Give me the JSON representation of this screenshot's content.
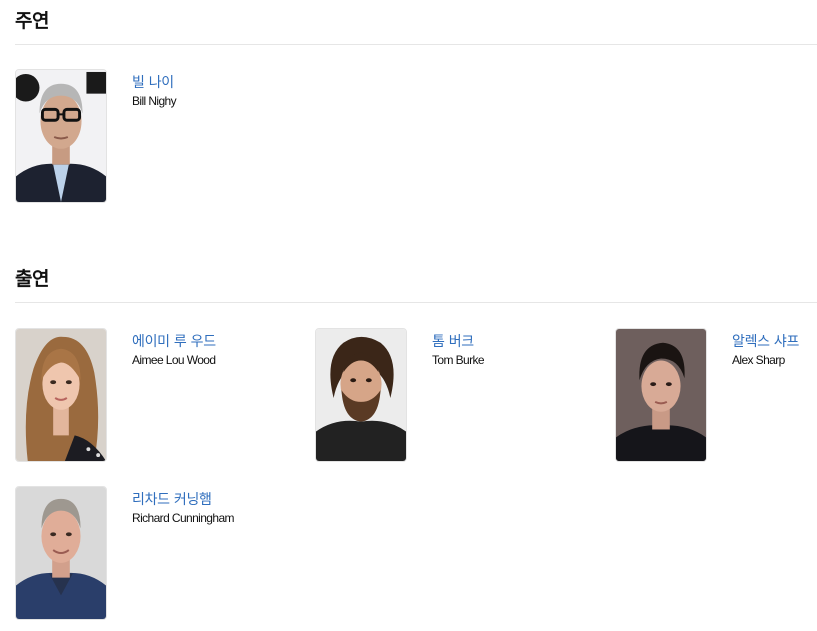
{
  "sections": {
    "lead": {
      "title": "주연",
      "people": [
        {
          "name_ko": "빌 나이",
          "name_en": "Bill Nighy",
          "photo": "actor-photo-bill-nighy"
        }
      ]
    },
    "supporting": {
      "title": "출연",
      "people": [
        {
          "name_ko": "에이미 루 우드",
          "name_en": "Aimee Lou Wood",
          "photo": "actor-photo-aimee-lou-wood"
        },
        {
          "name_ko": "톰 버크",
          "name_en": "Tom Burke",
          "photo": "actor-photo-tom-burke"
        },
        {
          "name_ko": "알렉스 샤프",
          "name_en": "Alex Sharp",
          "photo": "actor-photo-alex-sharp"
        },
        {
          "name_ko": "리차드 커닝햄",
          "name_en": "Richard Cunningham",
          "photo": "actor-photo-richard-cunningham"
        }
      ]
    }
  },
  "colors": {
    "link": "#2f6ebd",
    "divider": "#e6e6e6"
  }
}
